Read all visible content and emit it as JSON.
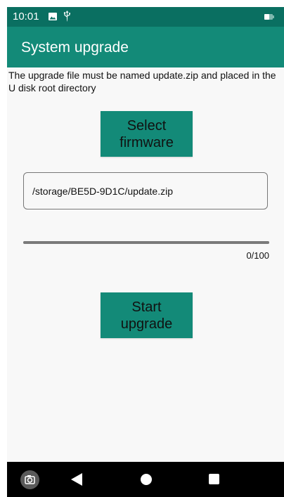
{
  "status_bar": {
    "time": "10:01",
    "icons": [
      "image-icon",
      "usb-icon",
      "battery-icon"
    ],
    "background": "#0a6f61"
  },
  "app_bar": {
    "title": "System upgrade",
    "background": "#138a78"
  },
  "info": {
    "message": "The upgrade file must be named update.zip and placed in the U disk root directory"
  },
  "select_firmware": {
    "label_line1": "Select",
    "label_line2": "firmware"
  },
  "path_field": {
    "value": "/storage/BE5D-9D1C/update.zip"
  },
  "progress": {
    "current": 0,
    "max": 100,
    "label": "0/100"
  },
  "start_upgrade": {
    "label_line1": "Start",
    "label_line2": "upgrade"
  },
  "nav_bar": {
    "buttons": [
      "camera-icon",
      "back-icon",
      "home-icon",
      "recents-icon"
    ]
  },
  "colors": {
    "accent": "#138a78",
    "status": "#0a6f61",
    "background": "#f8f8f8"
  }
}
